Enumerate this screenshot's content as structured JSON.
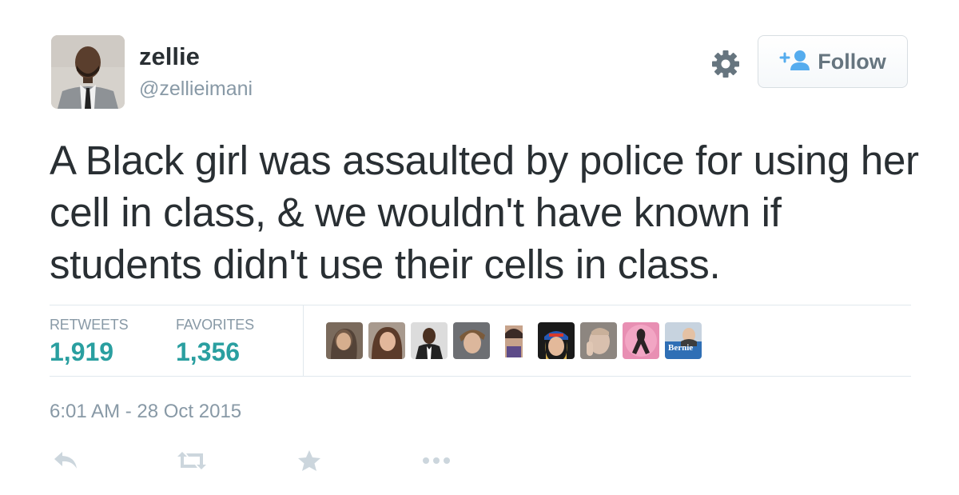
{
  "user": {
    "name": "zellie",
    "handle": "@zellieimani"
  },
  "header": {
    "settings_icon": "gear-icon",
    "follow_label": "Follow",
    "follow_icon": "add-user-icon"
  },
  "tweet": {
    "text": "A Black girl was assaulted by police for using her cell in class, & we wouldn't have known if students didn't use their cells in class.",
    "timestamp": "6:01 AM - 28 Oct 2015"
  },
  "stats": {
    "retweets_label": "RETWEETS",
    "retweets_value": "1,919",
    "favorites_label": "FAVORITES",
    "favorites_value": "1,356"
  },
  "favoriters": [
    {
      "icon": "user-avatar"
    },
    {
      "icon": "user-avatar"
    },
    {
      "icon": "user-avatar"
    },
    {
      "icon": "user-avatar"
    },
    {
      "icon": "user-avatar"
    },
    {
      "icon": "user-avatar"
    },
    {
      "icon": "user-avatar"
    },
    {
      "icon": "ribbon-avatar"
    },
    {
      "icon": "bernie-avatar",
      "text": "Bernie"
    }
  ],
  "actions": {
    "reply_icon": "reply-icon",
    "retweet_icon": "retweet-icon",
    "favorite_icon": "star-icon",
    "more_icon": "more-icon"
  },
  "colors": {
    "stat_value": "#2a9fa0",
    "muted": "#8899a6",
    "text": "#292f33",
    "action_icon": "#ccd6dd"
  }
}
